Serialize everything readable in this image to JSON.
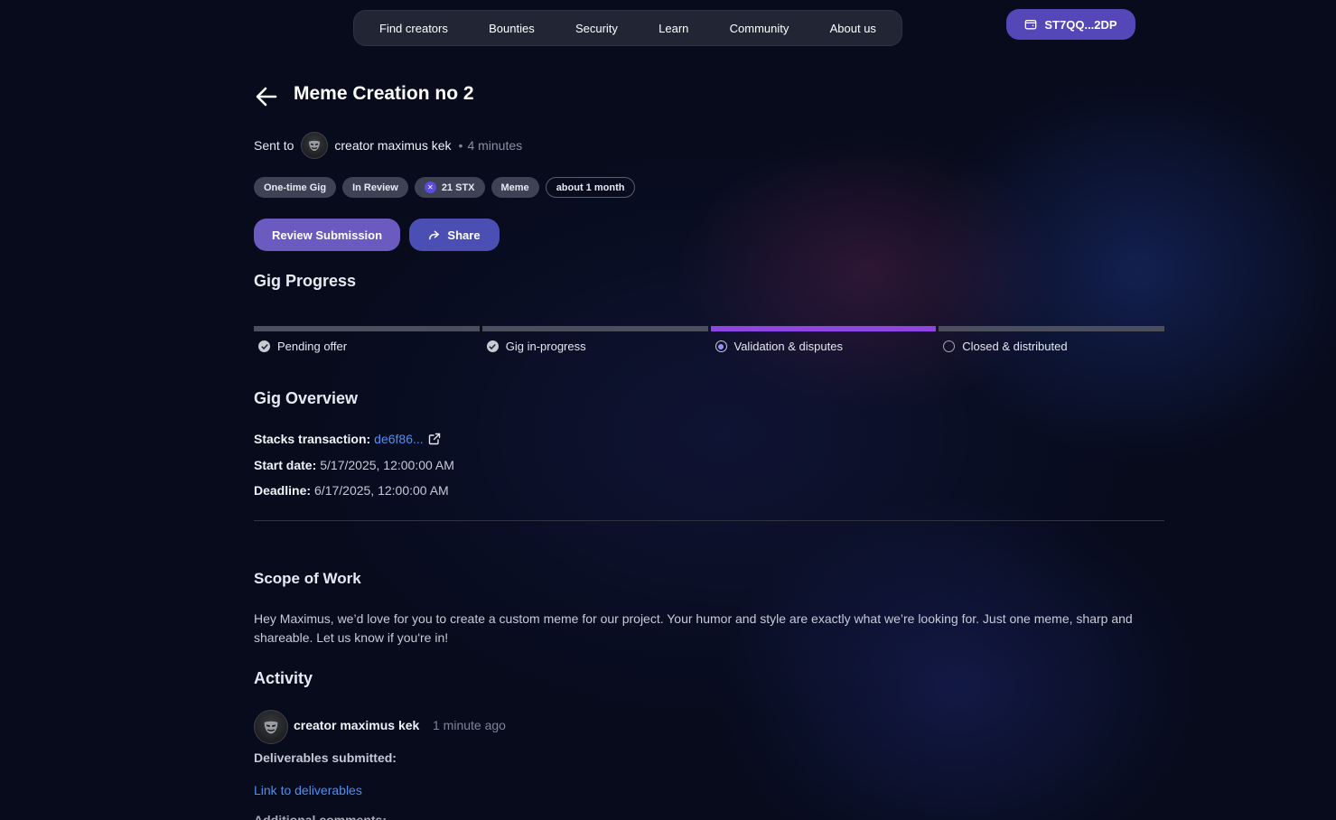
{
  "nav": {
    "items": [
      {
        "label": "Find creators"
      },
      {
        "label": "Bounties"
      },
      {
        "label": "Security"
      },
      {
        "label": "Learn"
      },
      {
        "label": "Community"
      },
      {
        "label": "About us"
      }
    ]
  },
  "wallet": {
    "label": "ST7QQ...2DP",
    "icon": "wallet-icon",
    "color": "#5647b8"
  },
  "gig": {
    "title": "Meme Creation no 2",
    "sent_to_label": "Sent to",
    "recipient": "creator maximus kek",
    "sent_ago": "4 minutes",
    "tags": [
      {
        "label": "One-time Gig"
      },
      {
        "label": "In Review"
      },
      {
        "label": "21 STX"
      },
      {
        "label": "Meme"
      },
      {
        "label": "about 1 month"
      }
    ]
  },
  "actions": {
    "review_label": "Review Submission",
    "share_label": "Share",
    "review_color": "#6b5bc0",
    "share_color": "#4b4fb4"
  },
  "progress": {
    "title": "Gig Progress",
    "accent": "#8f45e3",
    "current_step": 3,
    "steps": [
      {
        "label": "Pending offer",
        "state": "done"
      },
      {
        "label": "Gig in-progress",
        "state": "done"
      },
      {
        "label": "Validation & disputes",
        "state": "current"
      },
      {
        "label": "Closed & distributed",
        "state": "todo"
      }
    ]
  },
  "overview": {
    "title": "Gig Overview",
    "tx_label": "Stacks transaction:",
    "tx_value": "de6f86...",
    "start_label": "Start date:",
    "start_value": "5/17/2025, 12:00:00 AM",
    "deadline_label": "Deadline:",
    "deadline_value": "6/17/2025, 12:00:00 AM"
  },
  "scope": {
    "title": "Scope of Work",
    "text": "Hey Maximus, we’d love for you to create a custom meme for our project. Your humor and style are exactly what we’re looking for. Just one meme, sharp and shareable. Let us know if you're in!"
  },
  "activity": {
    "title": "Activity",
    "author": "creator maximus kek",
    "time": "1 minute ago",
    "deliverables_label": "Deliverables submitted:",
    "link_label": "Link to deliverables",
    "next_label": "Additional comments:"
  },
  "colors": {
    "link": "#4f8ff0",
    "background": "#070b1c"
  }
}
